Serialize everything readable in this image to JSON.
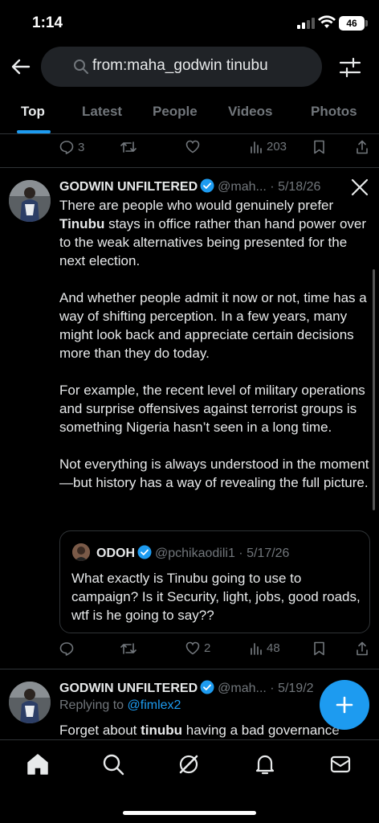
{
  "status": {
    "time": "1:14",
    "battery": "46"
  },
  "search": {
    "query": "from:maha_godwin tinubu"
  },
  "tabs": [
    {
      "label": "Top"
    },
    {
      "label": "Latest"
    },
    {
      "label": "People"
    },
    {
      "label": "Videos"
    },
    {
      "label": "Photos"
    }
  ],
  "prev_tweet": {
    "replies": "3",
    "views": "203"
  },
  "tweet": {
    "name": "GODWIN UNFILTERED",
    "meta": "@mah... · 5/18/26",
    "paragraphs": [
      "There are people who would genuinely prefer <b>Tinubu</b> stays in office rather than hand power over to the weak alternatives being presented for the next election.",
      "And whether people admit it now or not, time has a way of shifting perception. In a few years, many might look back and appreciate certain decisions more than they do today.",
      "For example, the recent level of military operations and surprise offensives against terrorist groups is something Nigeria hasn’t seen in a long time.",
      "Not everything is always understood in the moment—but history has a way of revealing the full picture."
    ],
    "likes": "2",
    "views": "48",
    "quote": {
      "name": "ODOH",
      "meta": "@pchikaodili1 · 5/17/26",
      "text": "What exactly is Tinubu going to use to campaign? Is it Security, light, jobs, good roads, wtf is he going to say??"
    }
  },
  "next_tweet": {
    "name": "GODWIN UNFILTERED",
    "meta": "@mah... · 5/19/2",
    "replying_prefix": "Replying to ",
    "replying_handle": "@fimlex2",
    "text_pre": "Forget about ",
    "text_bold": "tinubu",
    "text_post": " having a bad governance"
  },
  "colors": {
    "accent": "#1d9bf0",
    "muted": "#71767b",
    "text": "#e7e9ea",
    "border": "#2f3336"
  }
}
